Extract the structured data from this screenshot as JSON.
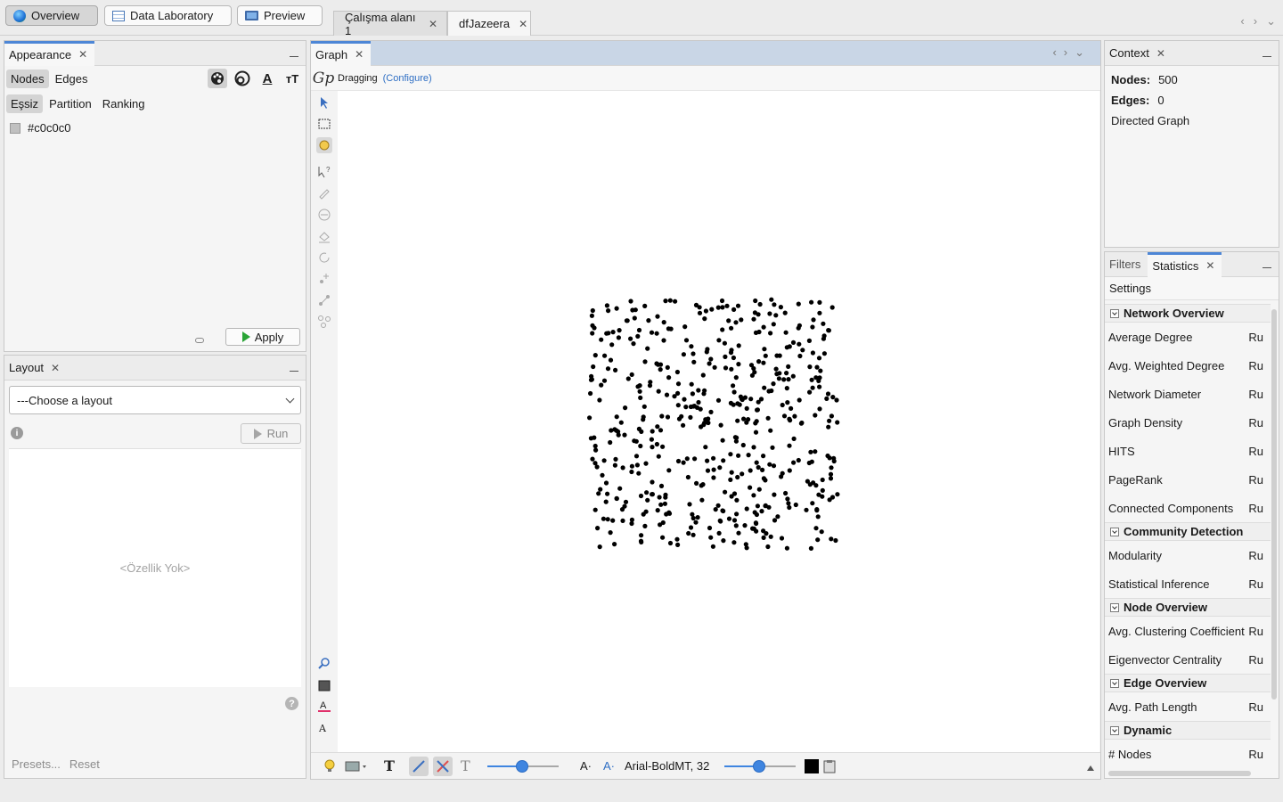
{
  "top": {
    "modes": [
      "Overview",
      "Data Laboratory",
      "Preview"
    ],
    "workspace_tabs": [
      "Çalışma alanı 1",
      "dfJazeera"
    ]
  },
  "appearance": {
    "panel_title": "Appearance",
    "element_tabs": [
      "Nodes",
      "Edges"
    ],
    "mode_tabs": [
      "Eşsiz",
      "Partition",
      "Ranking"
    ],
    "color_value": "#c0c0c0",
    "apply_label": "Apply"
  },
  "layout": {
    "panel_title": "Layout",
    "choose_placeholder": "---Choose a layout",
    "run_label": "Run",
    "no_property": "<Özellik Yok>",
    "presets_label": "Presets...",
    "reset_label": "Reset"
  },
  "graph": {
    "tab_title": "Graph",
    "mode_label": "Dragging",
    "configure_label": "(Configure)",
    "font_label": "Arial-BoldMT, 32",
    "node_color": "#000000",
    "node_count": 500
  },
  "context": {
    "tab_title": "Context",
    "nodes_label": "Nodes:",
    "nodes_value": "500",
    "edges_label": "Edges:",
    "edges_value": "0",
    "graph_type": "Directed Graph"
  },
  "statistics": {
    "tabs": [
      "Filters",
      "Statistics"
    ],
    "settings_label": "Settings",
    "run_label": "Ru",
    "categories": [
      {
        "name": "Network Overview",
        "items": [
          "Average Degree",
          "Avg. Weighted Degree",
          "Network Diameter",
          "Graph Density",
          "HITS",
          "PageRank",
          "Connected Components"
        ]
      },
      {
        "name": "Community Detection",
        "items": [
          "Modularity",
          "Statistical Inference"
        ]
      },
      {
        "name": "Node Overview",
        "items": [
          "Avg. Clustering Coefficient",
          "Eigenvector Centrality"
        ]
      },
      {
        "name": "Edge Overview",
        "items": [
          "Avg. Path Length"
        ]
      },
      {
        "name": "Dynamic",
        "items": [
          "# Nodes"
        ]
      }
    ]
  }
}
